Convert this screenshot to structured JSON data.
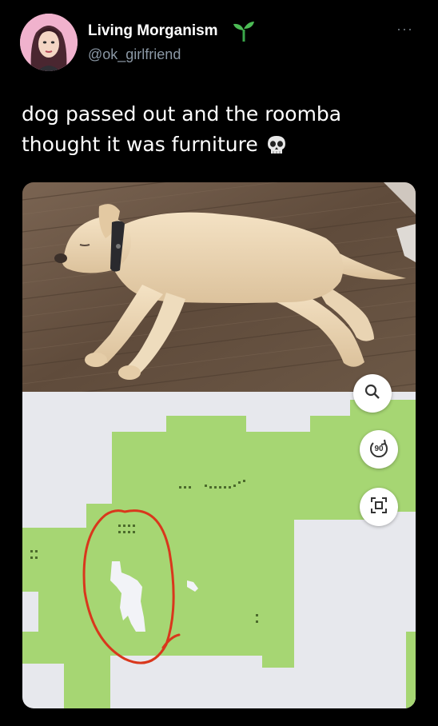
{
  "author": {
    "display_name": "Living Morganism",
    "handle": "@ok_girlfriend",
    "emoji_icon": "sprout-icon"
  },
  "more_label": "···",
  "tweet": {
    "text": "dog passed out and the roomba thought it was furniture",
    "emoji_icon": "skull-icon"
  },
  "media": {
    "photo_subject": "dog-photo",
    "map_controls": {
      "rotate_label": "90",
      "icons": [
        "zoom-icon",
        "rotate-icon",
        "recenter-icon"
      ]
    },
    "colors": {
      "map_floor": "#a6d673",
      "map_unexplored": "#e7e8ed",
      "annotation_circle": "#d9371c",
      "wood_floor": "#6e5a48"
    }
  }
}
